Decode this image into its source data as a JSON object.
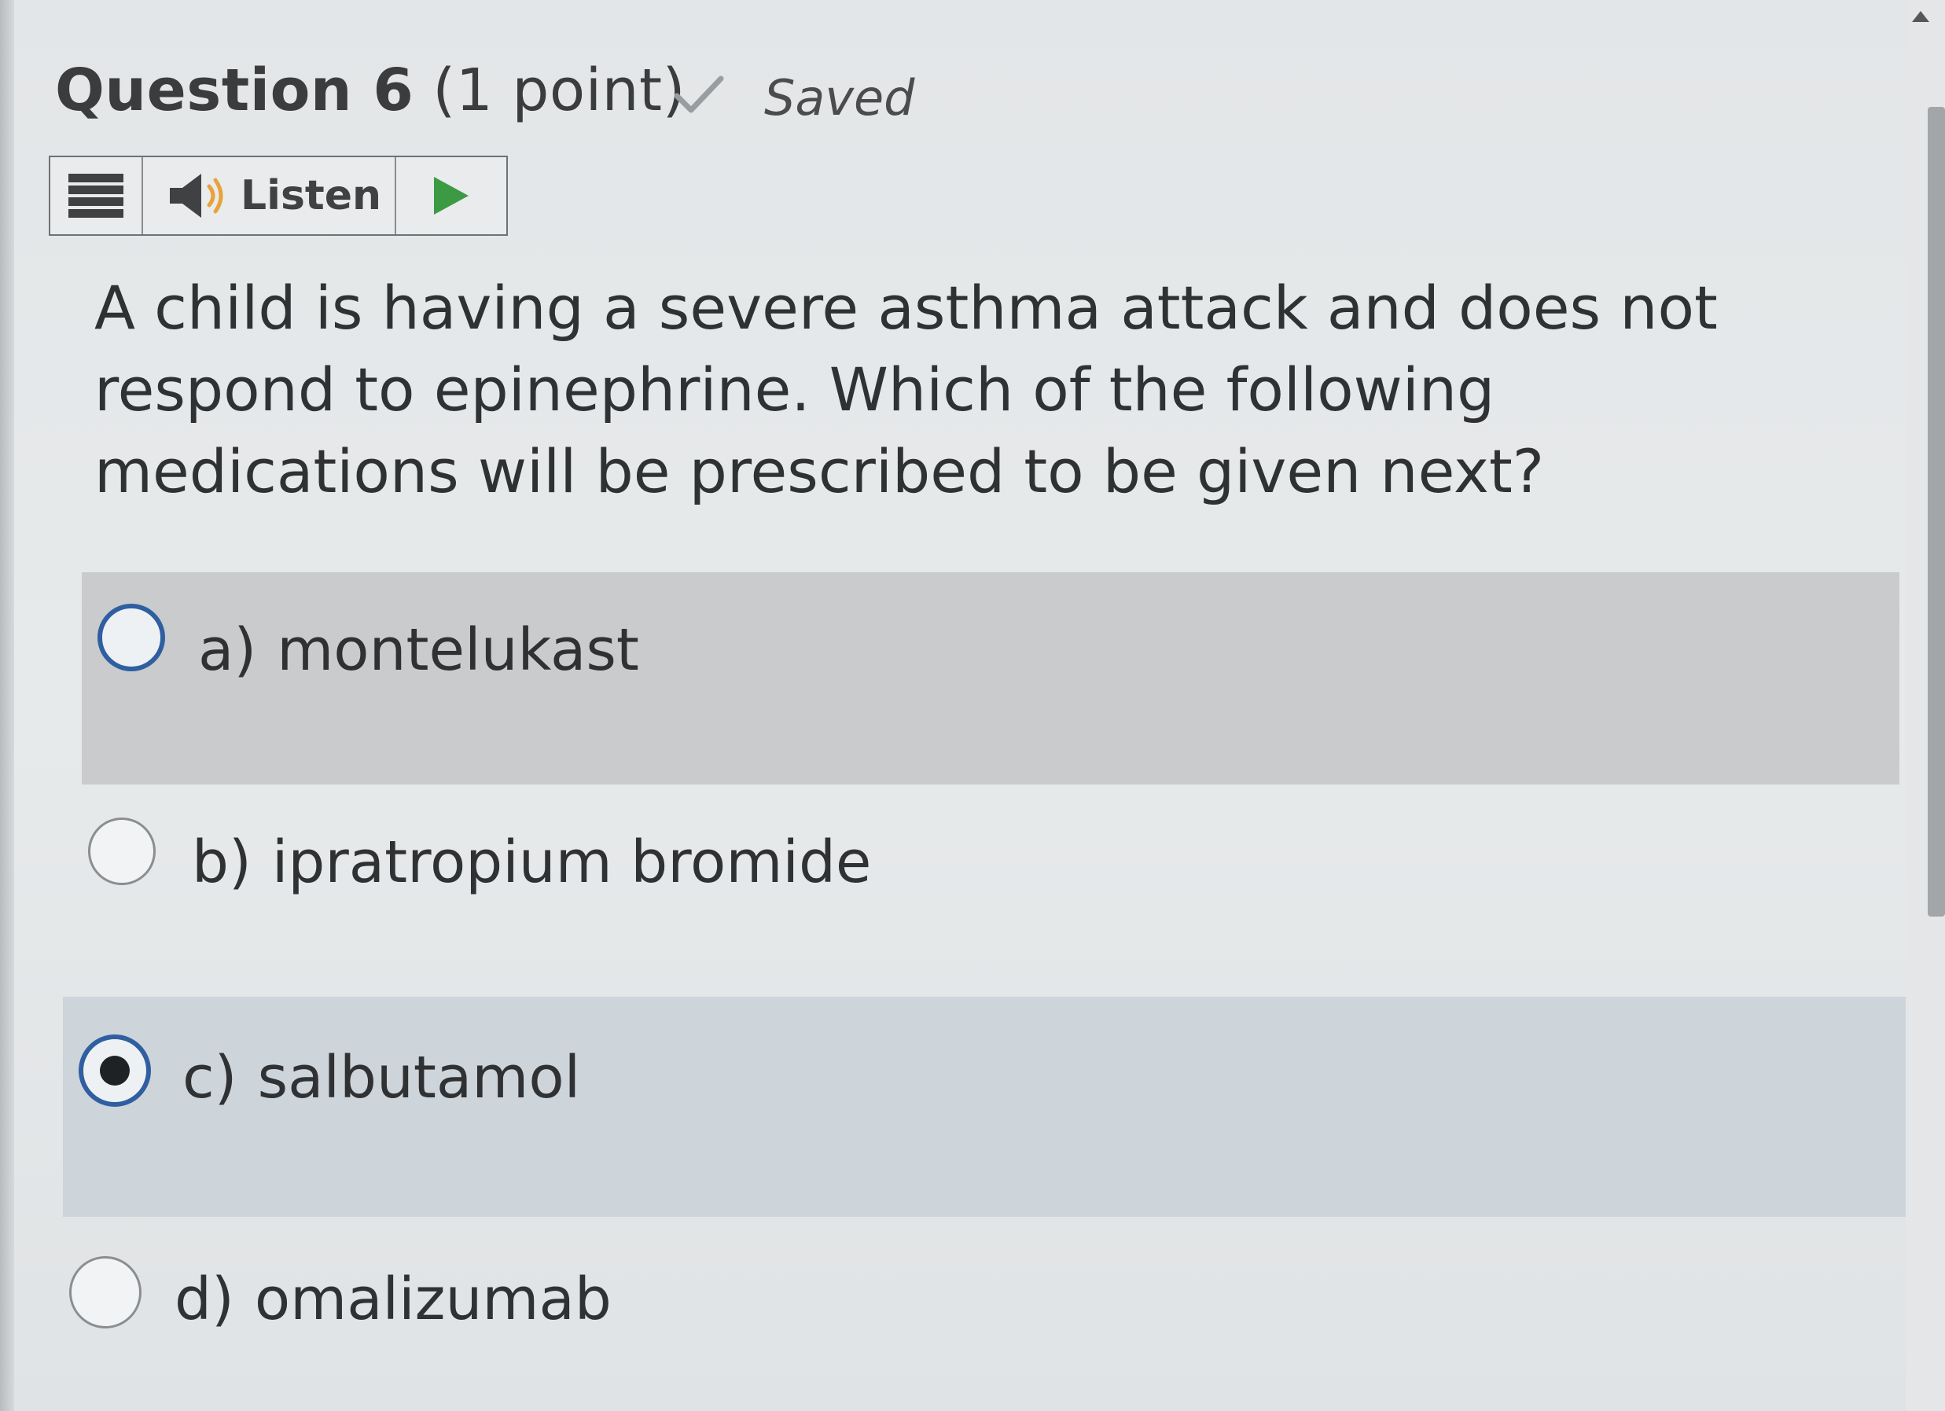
{
  "header": {
    "question_number": "Question 6",
    "points": "(1 point)",
    "saved_label": "Saved",
    "saved_icon": "check-icon"
  },
  "listen_toolbar": {
    "menu_icon": "menu-icon",
    "speaker_icon": "speaker-icon",
    "listen_label": "Listen",
    "play_icon": "play-icon"
  },
  "question": {
    "text": "A child is having a severe asthma attack and does not respond to epinephrine. Which of the following medications will be prescribed to be given next?"
  },
  "options": [
    {
      "letter": "a)",
      "label": "montelukast",
      "selected": false,
      "hovered": true
    },
    {
      "letter": "b)",
      "label": "ipratropium bromide",
      "selected": false,
      "hovered": false
    },
    {
      "letter": "c)",
      "label": "salbutamol",
      "selected": true,
      "hovered": false
    },
    {
      "letter": "d)",
      "label": "omalizumab",
      "selected": false,
      "hovered": false
    }
  ],
  "colors": {
    "accent_blue": "#2f5fa0",
    "play_green": "#3c9a45",
    "hover_bg": "#c9cbcd",
    "selected_bg": "#cdd4da"
  }
}
